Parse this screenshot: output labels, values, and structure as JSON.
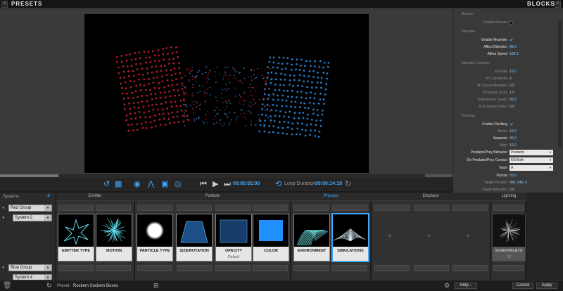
{
  "titlebar": {
    "left_title": "PRESETS",
    "right_title": "BLOCKS",
    "left_arrow": ">",
    "right_arrow": "<"
  },
  "transport": {
    "current_time": "00:00:02:00",
    "loop_label": "Loop Duration:",
    "loop_time": "00:00:14:18",
    "icons": [
      "undo-icon",
      "film-icon",
      "mesh-icon",
      "display-icon",
      "eye-icon",
      "skip-back-icon",
      "play-icon",
      "skip-forward-icon",
      "loop-icon",
      "reset-icon"
    ]
  },
  "inspector": {
    "bounce_head": "Bounce",
    "enable_bounce": "Enable Bounce",
    "meander_head": "Meander",
    "enable_meander": "Enable Meander",
    "affect_direction": {
      "label": "Affect Direction",
      "value": "89.0"
    },
    "affect_speed": {
      "label": "Affect Speed",
      "value": "109.0"
    },
    "meander_controls_head": "Meander Controls",
    "m_scale": {
      "label": "M Scale",
      "value": "10.0"
    },
    "m_complexity": {
      "label": "M Complexity",
      "value": "3"
    },
    "m_octave_multiplier": {
      "label": "M Octave Multiplier",
      "value": "0.5"
    },
    "m_octave_scale": {
      "label": "M Octave Scale",
      "value": "1.5"
    },
    "m_evolution_speed": {
      "label": "M Evolution Speed",
      "value": "50.0"
    },
    "m_evolution_offset": {
      "label": "M Evolution Offset",
      "value": "0.0"
    },
    "flocking_head": "Flocking",
    "enable_flocking": "Enable Flocking",
    "attract": {
      "label": "Attract",
      "value": "10.0"
    },
    "separate": {
      "label": "Separate",
      "value": "35.0"
    },
    "align": {
      "label": "Align",
      "value": "10.0"
    },
    "predator_behavior": {
      "label": "Predator/Prey Behavior",
      "value": "Predator"
    },
    "predator_contact": {
      "label": "On Predator/Prey Contact",
      "value": "Kill Both"
    },
    "team": {
      "label": "Team",
      "value": "A"
    },
    "pursuit": {
      "label": "Pursuit",
      "value": "50.0"
    },
    "target_position": {
      "label": "Target Position",
      "value": "960, 540, 0"
    },
    "target_attraction": {
      "label": "Target Attraction",
      "value": "0.0"
    }
  },
  "systems": {
    "title": "Systems",
    "add": "+",
    "group1": "Red Group",
    "system1": "System 2",
    "group2": "Blue Group",
    "system2": "System 4"
  },
  "categories": {
    "emitter": "Emitter",
    "particle": "Particle",
    "physics": "Physics",
    "displace": "Displace",
    "lighting": "Lighting"
  },
  "tiles": {
    "emitter_type": "EMITTER TYPE",
    "motion": "MOTION",
    "particle_type": "PARTICLE TYPE",
    "size_rotation": "SIZE/ROTATION",
    "opacity": "OPACITY",
    "opacity_sub": "Default",
    "color": "COLOR",
    "environment": "ENVIRONMENT",
    "simulations": "SIMULATIONS",
    "shadowlets": "SHADOWLETS",
    "shadowlets_sub": "Off"
  },
  "status": {
    "preset_label": "Preset:",
    "preset_name": "Rockem Sockem Boxes",
    "help": "Help...",
    "cancel": "Cancel",
    "apply": "Apply"
  },
  "colors": {
    "accent": "#3fa9ff",
    "red_particles": "#c0212a",
    "blue_particles": "#2a86d6"
  }
}
